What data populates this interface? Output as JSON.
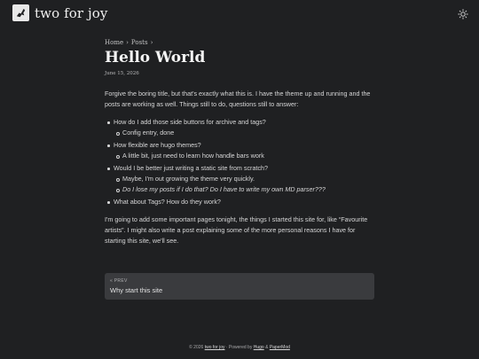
{
  "site": {
    "title": "two for joy"
  },
  "breadcrumb": {
    "home": "Home",
    "posts": "Posts",
    "sep": "›"
  },
  "post": {
    "title": "Hello World",
    "date": "June 15, 2026",
    "intro": "Forgive the boring title, but that's exactly what this is. I have the theme up and running and the posts are working as well. Things still to do, questions still to answer:",
    "questions": [
      {
        "q": "How do I add those side buttons for archive and tags?",
        "answers": [
          {
            "text": "Config entry, done",
            "italic": false
          }
        ]
      },
      {
        "q": "How flexible are hugo themes?",
        "answers": [
          {
            "text": "A little bit, just need to learn how handle bars work",
            "italic": false
          }
        ]
      },
      {
        "q": "Would I be better just writing a static site from scratch?",
        "answers": [
          {
            "text": "Maybe, I'm out growing the theme very quickly.",
            "italic": false
          },
          {
            "text": "Do I lose my posts if I do that? Do I have to write my own MD parser???",
            "italic": true
          }
        ]
      },
      {
        "q": "What about Tags? How do they work?",
        "answers": []
      }
    ],
    "outro": "I'm going to add some important pages tonight, the things I started this site for, like “Favourite artists”. I might also write a post explaining some of the more personal reasons I have for starting this site, we'll see."
  },
  "nav": {
    "prev_label": "« PREV",
    "prev_title": "Why start this site"
  },
  "footer": {
    "prefix": "© 2026",
    "site": "two for joy",
    "powered": "· Powered by",
    "hugo": "Hugo",
    "amp": "&",
    "theme": "PaperMod"
  }
}
